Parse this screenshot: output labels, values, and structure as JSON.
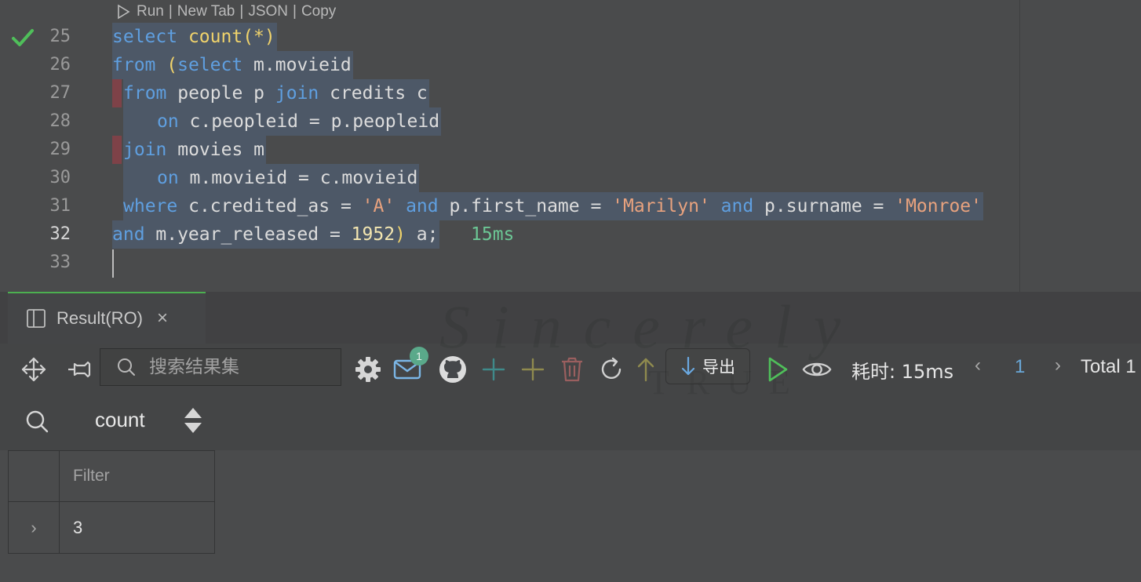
{
  "editor": {
    "codelens": {
      "run": "Run",
      "new_tab": "New Tab",
      "json": "JSON",
      "copy": "Copy",
      "sep": "|"
    },
    "lines": {
      "n25": "25",
      "n26": "26",
      "n27": "27",
      "n28": "28",
      "n29": "29",
      "n30": "30",
      "n31": "31",
      "n32": "32",
      "n33": "33"
    },
    "code": {
      "l25_k": "select",
      "l25_f": "count",
      "l25_r": "(*)",
      "l26_k": "from",
      "l26_p": "(",
      "l26_k2": "select",
      "l26_r": " m.movieid",
      "l27_k": "from",
      "l27_r1": " people p ",
      "l27_k2": "join",
      "l27_r2": " credits c",
      "l28_k": "on",
      "l28_r": " c.peopleid = p.peopleid",
      "l29_k": "join",
      "l29_r": " movies m",
      "l30_k": "on",
      "l30_r": " m.movieid = c.movieid",
      "l31_k": "where",
      "l31_r1": " c.credited_as = ",
      "l31_s1": "'A'",
      "l31_k2": "and",
      "l31_r2": " p.first_name = ",
      "l31_s2": "'Marilyn'",
      "l31_k3": "and",
      "l31_r3": " p.surname = ",
      "l31_s3": "'Monroe'",
      "l32_k": "and",
      "l32_r1": " m.year_released = ",
      "l32_n": "1952",
      "l32_p": ")",
      "l32_r2": " a;",
      "l32_time": "15ms"
    },
    "colors": {
      "keyword": "#5f9fe0",
      "function": "#f0d36b",
      "string": "#e8a27e",
      "success": "#4caf50"
    }
  },
  "tab": {
    "label": "Result(RO)",
    "close": "×"
  },
  "toolbar": {
    "search_placeholder": "搜索结果集",
    "badge_count": "1",
    "export_label": "导出",
    "elapsed": "耗时: 15ms",
    "page": "1",
    "total": "Total 1",
    "prev": "‹",
    "next": "›",
    "icons": [
      "move-icon",
      "pin-icon",
      "search-icon",
      "settings-icon",
      "mail-icon",
      "github-icon",
      "add-row-icon",
      "add-icon",
      "delete-icon",
      "refresh-icon",
      "submit-icon",
      "export-icon",
      "run-icon",
      "view-icon"
    ]
  },
  "result": {
    "column": "count",
    "filter_placeholder": "Filter",
    "rows": [
      {
        "expand": "›",
        "value": "3"
      }
    ]
  },
  "watermark": {
    "line1": "Sincerely",
    "line2": "TRUE"
  }
}
